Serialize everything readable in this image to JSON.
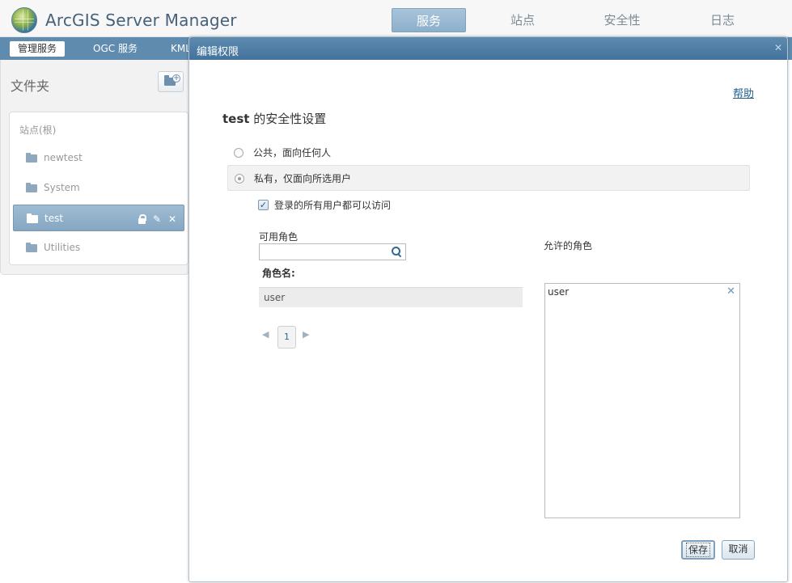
{
  "header": {
    "app_title": "ArcGIS Server Manager",
    "tabs": [
      {
        "label": "服务",
        "active": true
      },
      {
        "label": "站点",
        "active": false
      },
      {
        "label": "安全性",
        "active": false
      },
      {
        "label": "日志",
        "active": false
      }
    ]
  },
  "subnav": {
    "items": [
      {
        "label": "管理服务",
        "active": true
      },
      {
        "label": "OGC 服务",
        "active": false
      },
      {
        "label": "KML",
        "active": false
      }
    ]
  },
  "folders": {
    "title": "文件夹",
    "root_label": "站点(根)",
    "items": [
      {
        "label": "newtest",
        "selected": false
      },
      {
        "label": "System",
        "selected": false
      },
      {
        "label": "test",
        "selected": true
      },
      {
        "label": "Utilities",
        "selected": false
      }
    ],
    "icons": {
      "new_folder": "new-folder-icon",
      "folder": "folder-icon",
      "lock": "lock-icon",
      "edit": "pencil-icon",
      "delete": "close-icon"
    }
  },
  "dialog": {
    "title": "编辑权限",
    "help": "帮助",
    "heading_name": "test",
    "heading_suffix": " 的安全性设置",
    "radio_public": "公共，面向任何人",
    "radio_private": "私有，仅面向所选用户",
    "selected_access": "private",
    "checkbox_all_logged_in": "登录的所有用户都可以访问",
    "checkbox_checked": true,
    "available_roles_label": "可用角色",
    "search_value": "",
    "role_name_header": "角色名:",
    "available_roles": [
      "user"
    ],
    "pager": {
      "current_page": "1"
    },
    "allowed_roles_label": "允许的角色",
    "allowed_roles": [
      "user"
    ],
    "save_label": "保存",
    "cancel_label": "取消"
  },
  "colors": {
    "accent": "#5f8bae",
    "header_bar": "#4f7ea5",
    "link": "#205e8a"
  }
}
